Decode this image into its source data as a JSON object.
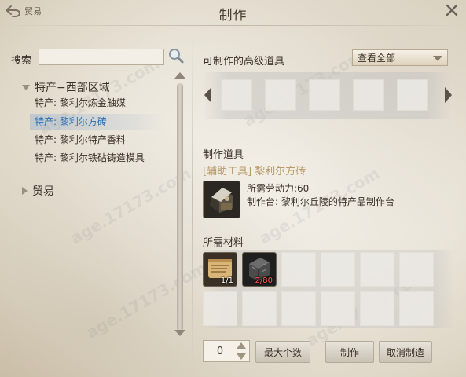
{
  "header": {
    "back_label": "贸易",
    "title": "制作"
  },
  "search": {
    "label": "搜索",
    "value": ""
  },
  "tree": {
    "group1": {
      "label": "特产−西部区域",
      "items": [
        {
          "label": "特产: 黎利尔炼金触媒"
        },
        {
          "label": "特产: 黎利尔方砖"
        },
        {
          "label": "特产: 黎利尔特产香料"
        },
        {
          "label": "特产: 黎利尔铁砧铸造模具"
        }
      ],
      "selected_index": 1
    },
    "group2": {
      "label": "贸易"
    }
  },
  "advanced": {
    "title": "可制作的高级道具",
    "filter_selected": "查看全部"
  },
  "craft": {
    "title": "制作道具",
    "item_name": "[辅助工具] 黎利尔方砖",
    "labor_text": "所需劳动力:60",
    "station_text": "制作台: 黎利尔丘陵的特产品制作台"
  },
  "materials": {
    "title": "所需材料",
    "items": [
      {
        "name": "scroll-material-icon",
        "count": "1/1",
        "sufficient": true
      },
      {
        "name": "stone-block-material-icon",
        "count": "2/80",
        "sufficient": false
      }
    ]
  },
  "controls": {
    "quantity": "0",
    "max_label": "最大个数",
    "craft_label": "制作",
    "cancel_label": "取消制造"
  },
  "colors": {
    "selected_text": "#2c6fb2",
    "item_name": "#b89a6a",
    "insufficient": "#ff5a4a"
  },
  "watermarks": [
    "age.17173.com",
    "age.17173.com",
    "age.17173.com",
    "age.17173.com",
    "age.17173.com",
    "age.17173.com"
  ]
}
